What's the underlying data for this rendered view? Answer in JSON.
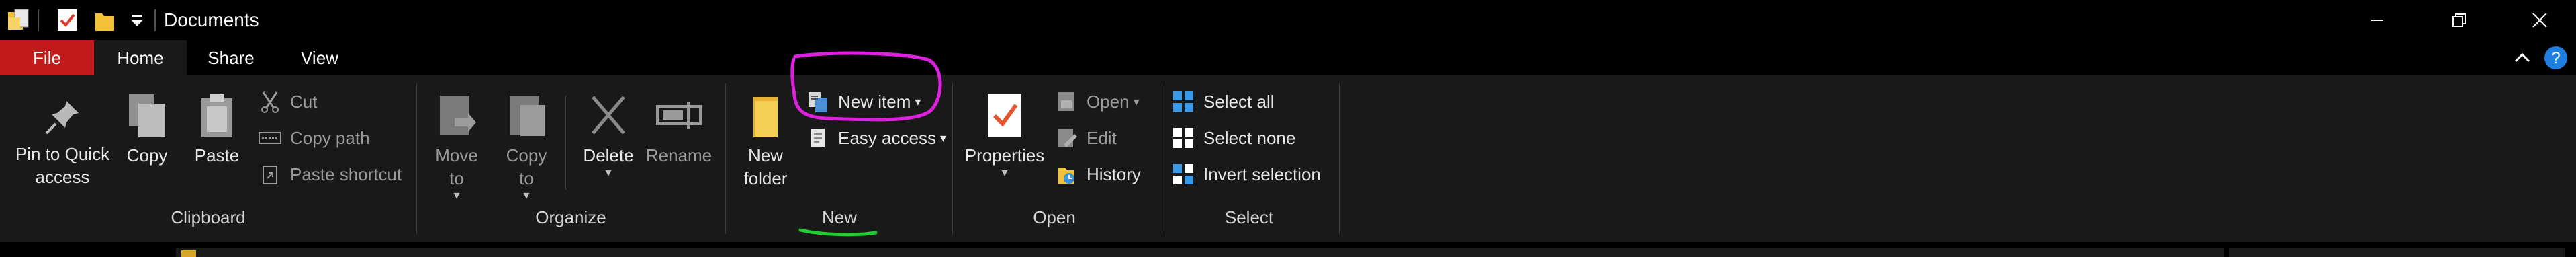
{
  "window": {
    "title": "Documents"
  },
  "tabs": {
    "file": "File",
    "home": "Home",
    "share": "Share",
    "view": "View"
  },
  "clipboard": {
    "pin": "Pin to Quick",
    "pin2": "access",
    "copy": "Copy",
    "paste": "Paste",
    "cut": "Cut",
    "copy_path": "Copy path",
    "paste_shortcut": "Paste shortcut",
    "label": "Clipboard"
  },
  "organize": {
    "move": "Move",
    "move2": "to",
    "copy": "Copy",
    "copy2": "to",
    "delete": "Delete",
    "rename": "Rename",
    "label": "Organize"
  },
  "new": {
    "new_folder": "New",
    "new_folder2": "folder",
    "new_item": "New item",
    "easy_access": "Easy access",
    "label": "New"
  },
  "open": {
    "properties": "Properties",
    "open": "Open",
    "edit": "Edit",
    "history": "History",
    "label": "Open"
  },
  "select": {
    "select_all": "Select all",
    "select_none": "Select none",
    "invert": "Invert selection",
    "label": "Select"
  },
  "colors": {
    "file_tab": "#c21a1a",
    "ribbon_bg": "#191919",
    "annotation_circle": "#e020e0",
    "annotation_underline": "#22cc33",
    "help": "#1e7fe0"
  }
}
